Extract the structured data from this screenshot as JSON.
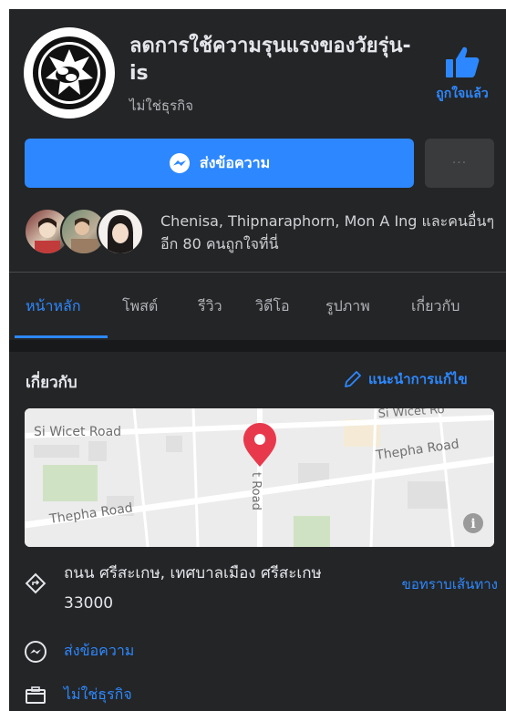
{
  "page": {
    "title": "ลดการใช้ความรุนแรงของวัยรุ่น-is",
    "category": "ไม่ใช่ธุรกิจ",
    "liked_label": "ถูกใจแล้ว"
  },
  "actions": {
    "message_label": "ส่งข้อความ",
    "more_label": "···"
  },
  "friends": {
    "text": "Chenisa, Thipnaraphorn, Mon A Ing และคนอื่นๆ อีก 80 คนถูกใจที่นี่"
  },
  "tabs": [
    {
      "label": "หน้าหลัก",
      "active": true
    },
    {
      "label": "โพสต์"
    },
    {
      "label": "รีวิว"
    },
    {
      "label": "วิดีโอ"
    },
    {
      "label": "รูปภาพ"
    },
    {
      "label": "เกี่ยวกับ"
    }
  ],
  "about": {
    "title": "เกี่ยวกับ",
    "suggest_edit": "แนะนำการแก้ไข",
    "map": {
      "roads": [
        "Si Wicet Road",
        "Si Wicet Ro",
        "Thepha Road",
        "Thepha Road",
        "t Road"
      ]
    },
    "address": "ถนน ศรีสะเกษ, เทศบาลเมือง ศรีสะเกษ 33000",
    "directions_label": "ขอทราบเส้นทาง",
    "message_label": "ส่งข้อความ",
    "category_label": "ไม่ใช่ธุรกิจ"
  },
  "colors": {
    "background": "#242526",
    "accent": "#2d88ff",
    "text": "#e4e6eb",
    "secondary_text": "#b0b3b8",
    "map_pin": "#e8394c"
  },
  "icons": [
    "page-logo-icon",
    "thumbs-up-icon",
    "messenger-icon",
    "more-icon",
    "pencil-icon",
    "directions-icon",
    "info-icon",
    "map-pin-icon",
    "category-icon"
  ]
}
